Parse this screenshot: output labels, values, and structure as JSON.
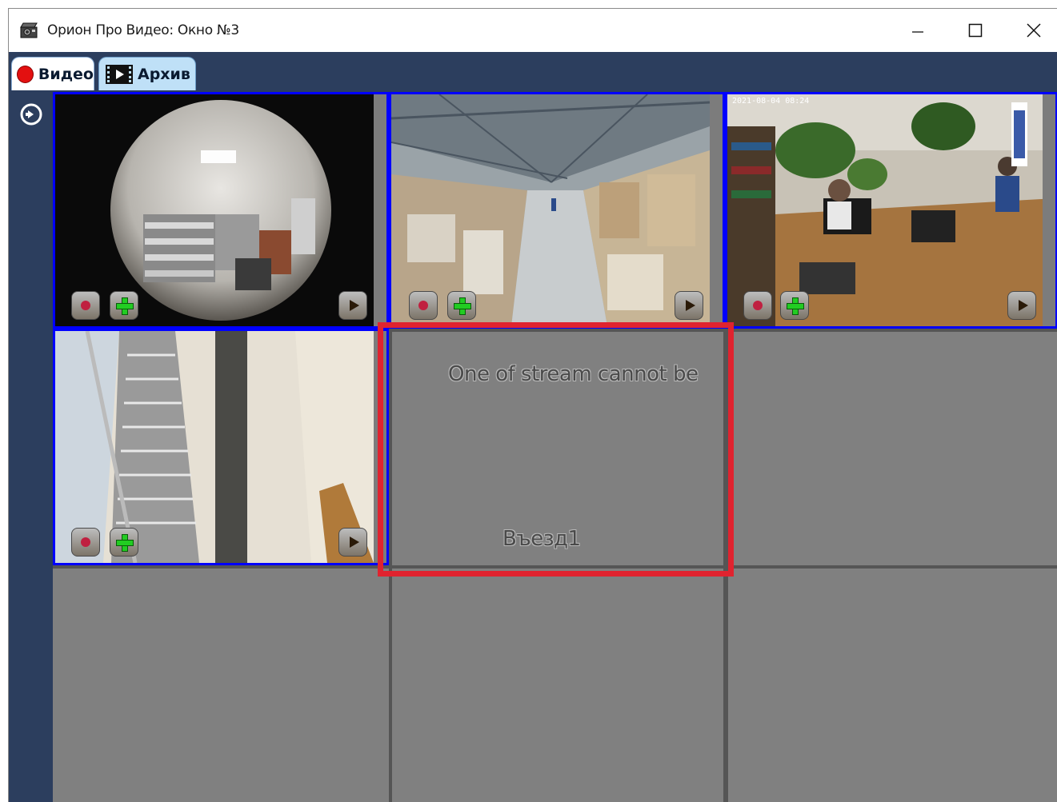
{
  "window": {
    "title": "Орион Про Видео: Окно №3",
    "icon": "camera-clapper-icon"
  },
  "titlebar_buttons": [
    "minimize-icon",
    "maximize-icon",
    "close-icon"
  ],
  "tabs": [
    {
      "label": "Видео",
      "icon": "record-dot-icon",
      "active": true
    },
    {
      "label": "Архив",
      "icon": "film-icon",
      "active": false
    }
  ],
  "sidebar": {
    "icon": "expand-arrow-icon"
  },
  "grid": {
    "rows": 3,
    "cols": 3,
    "cells": [
      {
        "id": "cam1",
        "state": "video",
        "scene": "fisheye-showroom",
        "controls": [
          "record",
          "add",
          "play"
        ]
      },
      {
        "id": "cam2",
        "state": "video",
        "scene": "warehouse",
        "controls": [
          "record",
          "add",
          "play"
        ]
      },
      {
        "id": "cam3",
        "state": "video",
        "scene": "office",
        "timestamp": "2021-08-04 08:24",
        "controls": [
          "record",
          "add",
          "play"
        ]
      },
      {
        "id": "cam4",
        "state": "video",
        "scene": "staircase",
        "controls": [
          "record",
          "add",
          "play"
        ]
      },
      {
        "id": "cam5",
        "state": "error",
        "message": "One of stream cannot be",
        "camera_name": "Въезд1"
      },
      {
        "id": "cam6",
        "state": "empty"
      },
      {
        "id": "cam7",
        "state": "empty"
      },
      {
        "id": "cam8",
        "state": "empty"
      },
      {
        "id": "cam9",
        "state": "empty"
      }
    ]
  },
  "colors": {
    "frame": "#2c3e5e",
    "cell_bg": "#808080",
    "active_border": "#0000ff",
    "highlight": "#e0232f",
    "record": "#e31010"
  }
}
